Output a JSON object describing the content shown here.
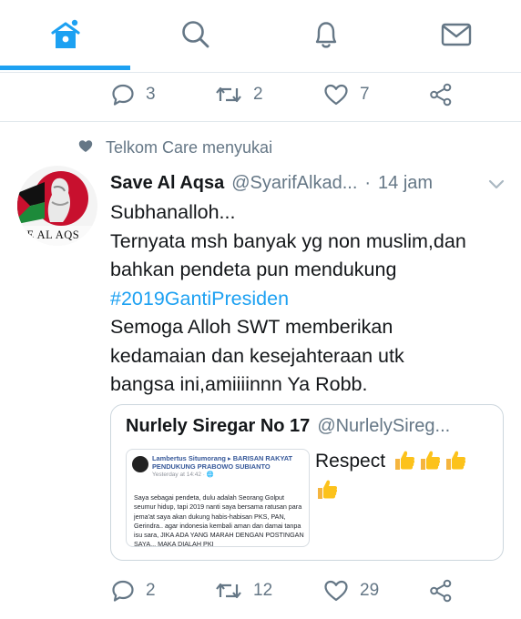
{
  "nav": {
    "tabs": [
      {
        "name": "home",
        "icon": "home-icon",
        "active": true
      },
      {
        "name": "search",
        "icon": "search-icon",
        "active": false
      },
      {
        "name": "notifications",
        "icon": "bell-icon",
        "active": false
      },
      {
        "name": "messages",
        "icon": "mail-icon",
        "active": false
      }
    ],
    "accent_color": "#1da1f2"
  },
  "prev_tweet": {
    "reply_count": "3",
    "retweet_count": "2",
    "like_count": "7"
  },
  "tweet": {
    "social_context": "Telkom Care menyukai",
    "author_name": "Save Al Aqsa",
    "author_handle": "@SyarifAlkad...",
    "dot": "·",
    "time": "14 jam",
    "avatar_text": "VE AL AQS",
    "lines": [
      "Subhanalloh...",
      "Ternyata msh banyak yg non muslim,dan",
      "bahkan pendeta pun mendukung"
    ],
    "hashtag": "#2019GantiPresiden",
    "lines2": [
      "Semoga Alloh SWT memberikan",
      "kedamaian dan kesejahteraan utk",
      "bangsa ini,amiiiinnn Ya Robb."
    ],
    "quote": {
      "name": "Nurlely Siregar No 17",
      "handle": "@NurlelySireg...",
      "text": "Respect",
      "emoji_name": "thumbs-up-emoji",
      "thumb_header": "Lambertus Situmorang ▸ BARISAN RAKYAT PENDUKUNG PRABOWO SUBIANTO",
      "thumb_time": "Yesterday at 14:42 · 🌐",
      "thumb_body": "Saya sebagai pendeta, dulu adalah Seorang Golput seumur hidup, tapi 2019 nanti saya bersama ratusan para jema'at saya akan dukung habis-habisan PKS, PAN, Gerindra.. agar indonesia kembali aman dan damai tanpa isu sara, JIKA ADA YANG MARAH DENGAN POSTINGAN SAYA... MAKA DIALAH PKI"
    },
    "reply_count": "2",
    "retweet_count": "12",
    "like_count": "29",
    "muted_color": "#657786"
  }
}
